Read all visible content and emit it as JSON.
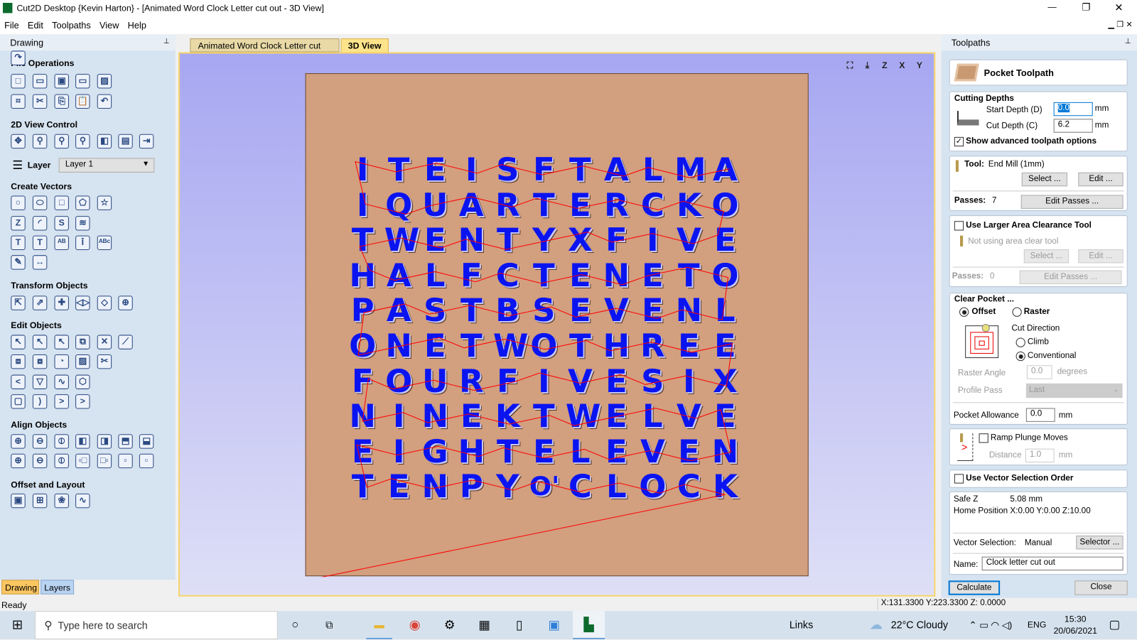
{
  "window": {
    "title": "Cut2D Desktop {Kevin Harton} - [Animated Word Clock Letter cut out - 3D View]",
    "minimize": "—",
    "restore": "❐",
    "close": "✕"
  },
  "menu": [
    "File",
    "Edit",
    "Toolpaths",
    "View",
    "Help"
  ],
  "left_panel": {
    "title": "Drawing",
    "pin": "📌",
    "sections": {
      "file_ops": "File Operations",
      "view_control": "2D View Control",
      "create_vectors": "Create Vectors",
      "transform": "Transform Objects",
      "edit": "Edit Objects",
      "align": "Align Objects",
      "offset": "Offset and Layout"
    },
    "layer_label": "Layer",
    "layer_value": "Layer 1",
    "tabs": [
      "Drawing",
      "Layers"
    ]
  },
  "icons": {
    "file_ops": [
      [
        "new-file-icon",
        "□"
      ],
      [
        "open-icon",
        "▭"
      ],
      [
        "save-icon",
        "▣"
      ],
      [
        "open-recent-icon",
        "▭"
      ],
      [
        "import-image-icon",
        "▨"
      ],
      [
        "select-all-icon",
        "⌗"
      ],
      [
        "cut-icon",
        "✂"
      ],
      [
        "copy-icon",
        "⎘"
      ],
      [
        "paste-icon",
        "📋"
      ],
      [
        "undo-icon",
        "↶"
      ],
      [
        "redo-icon",
        "↷"
      ]
    ],
    "view_control": [
      [
        "pan-icon",
        "✥"
      ],
      [
        "zoom-icon",
        "⚲"
      ],
      [
        "zoom-extents-icon",
        "⚲"
      ],
      [
        "zoom-box-icon",
        "⚲"
      ],
      [
        "view-left-icon",
        "◧"
      ],
      [
        "view-center-icon",
        "▤"
      ],
      [
        "view-right-icon",
        "⇥"
      ]
    ],
    "create_vectors": [
      [
        "circle-icon",
        "○"
      ],
      [
        "ellipse-icon",
        "⬭"
      ],
      [
        "rectangle-icon",
        "□"
      ],
      [
        "polygon-icon",
        "⬠"
      ],
      [
        "star-icon",
        "☆"
      ],
      [
        "polyline-icon",
        "Z"
      ],
      [
        "arc-icon",
        "◜"
      ],
      [
        "curve-icon",
        "S"
      ],
      [
        "fill-pattern-icon",
        "≋"
      ],
      [
        "text-icon",
        "T"
      ],
      [
        "text-box-icon",
        "T"
      ],
      [
        "text-on-curve-icon",
        "ᴬᴮ"
      ],
      [
        "auto-layout-text-icon",
        "Ī"
      ],
      [
        "arc-text-icon",
        "ᴬᴮᶜ"
      ],
      [
        "bitmap-trace-icon",
        "✎"
      ],
      [
        "dimension-icon",
        "↔"
      ]
    ],
    "transform": [
      [
        "move-icon",
        "⇱"
      ],
      [
        "scale-icon",
        "⇗"
      ],
      [
        "align-center-icon",
        "✚"
      ],
      [
        "mirror-icon",
        "◁▷"
      ],
      [
        "distort-icon",
        "◇"
      ],
      [
        "center-in-material-icon",
        "⊕"
      ]
    ],
    "edit": [
      [
        "select-icon",
        "↖"
      ],
      [
        "node-edit-icon",
        "↖"
      ],
      [
        "transform-mode-icon",
        "↖"
      ],
      [
        "group-icon",
        "⧉"
      ],
      [
        "ungroup-icon",
        "✕"
      ],
      [
        "measure-icon",
        "⟋"
      ],
      [
        "weld-icon",
        "⧈"
      ],
      [
        "subtract-icon",
        "⧇"
      ],
      [
        "intersect-icon",
        "◔"
      ],
      [
        "fillet-icon",
        "▨"
      ],
      [
        "trim-icon",
        "✂"
      ],
      [
        "smooth-icon",
        "<"
      ],
      [
        "join-icon",
        "▽"
      ],
      [
        "curve-fit-icon",
        "∿"
      ],
      [
        "close-vector-icon",
        "⬡"
      ],
      [
        "offset-nodes-icon",
        "▢"
      ],
      [
        "corner-icon-1",
        ")"
      ],
      [
        "corner-icon-2",
        ">"
      ],
      [
        "corner-icon-3",
        ">"
      ]
    ],
    "align": [
      [
        "align-center-both-icon",
        "⊕"
      ],
      [
        "align-center-h-icon",
        "⊖"
      ],
      [
        "align-center-v-icon",
        "⦶"
      ],
      [
        "align-left-icon",
        "◧"
      ],
      [
        "align-right-icon",
        "◨"
      ],
      [
        "align-top-icon",
        "⬒"
      ],
      [
        "align-bottom-icon",
        "⬓"
      ],
      [
        "align-group-center-icon",
        "⊕"
      ],
      [
        "align-group-h-icon",
        "⊖"
      ],
      [
        "align-group-v-icon",
        "⦶"
      ],
      [
        "align-to-left-icon",
        "▫□"
      ],
      [
        "align-to-right-icon",
        "□▫"
      ],
      [
        "align-to-top-icon",
        "▫"
      ],
      [
        "align-to-bottom-icon",
        "▫"
      ]
    ],
    "offset": [
      [
        "offset-icon",
        "▣"
      ],
      [
        "array-copy-icon",
        "⊞"
      ],
      [
        "nesting-icon",
        "❀"
      ],
      [
        "link-vectors-icon",
        "∿"
      ]
    ]
  },
  "doc_tabs": [
    "Animated Word Clock Letter cut out",
    "3D View"
  ],
  "view_toolbar": [
    [
      "zoom-extents-icon",
      "⛶"
    ],
    [
      "view-iso-icon",
      "⤓"
    ],
    [
      "view-z-icon",
      "Z"
    ],
    [
      "view-x-icon",
      "X"
    ],
    [
      "view-y-icon",
      "Y"
    ]
  ],
  "letter_grid": [
    [
      "I",
      "T",
      "E",
      "I",
      "S",
      "F",
      "T",
      "A",
      "L",
      "M",
      "A"
    ],
    [
      "I",
      "Q",
      "U",
      "A",
      "R",
      "T",
      "E",
      "R",
      "C",
      "K",
      "O"
    ],
    [
      "T",
      "W",
      "E",
      "N",
      "T",
      "Y",
      "X",
      "F",
      "I",
      "V",
      "E"
    ],
    [
      "H",
      "A",
      "L",
      "F",
      "C",
      "T",
      "E",
      "N",
      "E",
      "T",
      "O"
    ],
    [
      "P",
      "A",
      "S",
      "T",
      "B",
      "S",
      "E",
      "V",
      "E",
      "N",
      "L"
    ],
    [
      "O",
      "N",
      "E",
      "T",
      "W",
      "O",
      "T",
      "H",
      "R",
      "E",
      "E"
    ],
    [
      "F",
      "O",
      "U",
      "R",
      "F",
      "I",
      "V",
      "E",
      "S",
      "I",
      "X"
    ],
    [
      "N",
      "I",
      "N",
      "E",
      "K",
      "T",
      "W",
      "E",
      "L",
      "V",
      "E"
    ],
    [
      "E",
      "I",
      "G",
      "H",
      "T",
      "E",
      "L",
      "E",
      "V",
      "E",
      "N"
    ],
    [
      "T",
      "E",
      "N",
      "P",
      "Y",
      "O'",
      "C",
      "L",
      "O",
      "C",
      "K"
    ]
  ],
  "colors": {
    "letters": "#0a14f0",
    "toolpath": "#ff0000",
    "material": "#d29f7f"
  },
  "right_panel": {
    "title": "Toolpaths",
    "pin": "📌",
    "header": "Pocket Toolpath",
    "cutting_depths": {
      "title": "Cutting Depths",
      "start_label": "Start Depth (D)",
      "start_value": "0.0",
      "cut_label": "Cut Depth (C)",
      "cut_value": "6.2",
      "unit": "mm",
      "advanced_label": "Show advanced toolpath options",
      "advanced_checked": true
    },
    "tool": {
      "label": "Tool:",
      "value": "End Mill (1mm)",
      "select": "Select ...",
      "edit": "Edit ...",
      "passes_label": "Passes:",
      "passes_value": "7",
      "edit_passes": "Edit Passes ..."
    },
    "area_clear": {
      "label": "Use Larger Area Clearance Tool",
      "checked": false,
      "status": "Not using area clear tool",
      "select": "Select ...",
      "edit": "Edit ...",
      "passes_label": "Passes:",
      "passes_value": "0",
      "edit_passes": "Edit Passes ..."
    },
    "clear_pocket": {
      "title": "Clear Pocket ...",
      "offset": "Offset",
      "raster": "Raster",
      "selected": "Offset",
      "cut_direction": "Cut Direction",
      "climb": "Climb",
      "conventional": "Conventional",
      "direction_selected": "Conventional",
      "raster_angle_label": "Raster Angle",
      "raster_angle": "0.0",
      "degrees": "degrees",
      "profile_pass_label": "Profile Pass",
      "profile_pass": "Last",
      "allowance_label": "Pocket Allowance",
      "allowance": "0.0",
      "unit": "mm"
    },
    "ramp": {
      "label": "Ramp Plunge Moves",
      "checked": false,
      "distance_label": "Distance",
      "distance": "1.0",
      "unit": "mm"
    },
    "vector_order": {
      "label": "Use Vector Selection Order",
      "checked": false
    },
    "info": {
      "safe_z_label": "Safe Z",
      "safe_z": "5.08 mm",
      "home_label": "Home Position",
      "home": "X:0.00 Y:0.00 Z:10.00",
      "vector_sel_label": "Vector Selection:",
      "vector_sel": "Manual",
      "selector": "Selector ...",
      "name_label": "Name:",
      "name_value": "Clock letter cut out"
    },
    "calculate": "Calculate",
    "close": "Close"
  },
  "status": {
    "text": "Ready",
    "coords": "X:131.3300 Y:223.3300 Z:  0.0000"
  },
  "taskbar": {
    "search_placeholder": "Type here to search",
    "links": "Links",
    "weather": "22°C  Cloudy",
    "lang": "ENG",
    "time": "15:30",
    "date": "20/06/2021"
  }
}
